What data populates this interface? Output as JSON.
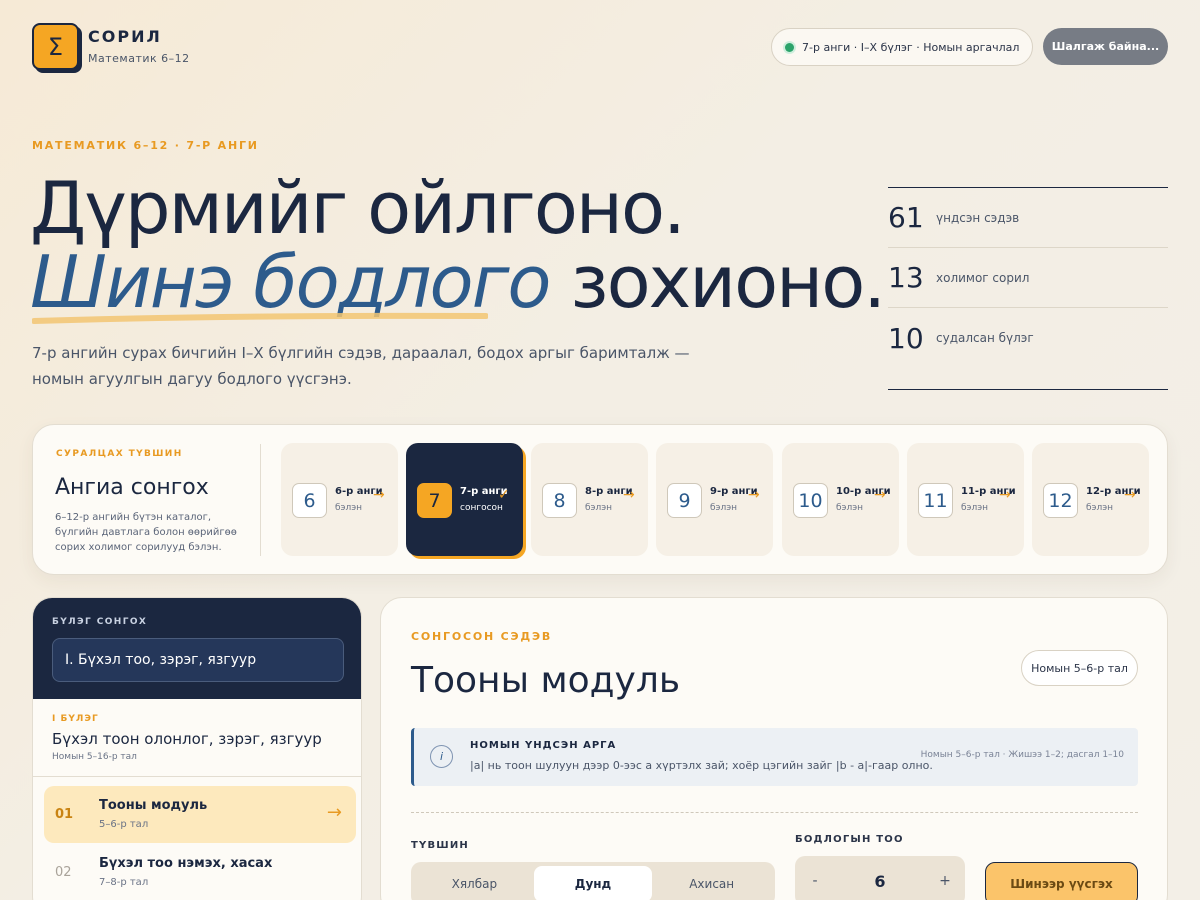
{
  "brand": {
    "logo_symbol": "Σ",
    "name": "СОРИЛ",
    "subtitle": "Математик 6–12",
    "accent": "#f5a623"
  },
  "header": {
    "context": "7-р анги · I–X бүлэг · Номын аргачлал",
    "status_button": "Шалгаж байна..."
  },
  "hero": {
    "eyebrow": "МАТЕМАТИК 6–12 · 7-Р АНГИ",
    "line1": "Дүрмийг ойлгоно.",
    "line2_accent": "Шинэ бодлого",
    "line2_rest": " зохионо.",
    "lead": "7-р ангийн сурах бичгийн I–X бүлгийн сэдэв, дараалал, бодох аргыг баримталж — номын агуулгын дагуу бодлого үүсгэнэ."
  },
  "stats": [
    {
      "value": "61",
      "label": "үндсэн сэдэв"
    },
    {
      "value": "13",
      "label": "холимог сорил"
    },
    {
      "value": "10",
      "label": "судалсан бүлэг"
    }
  ],
  "grade_picker": {
    "eyebrow": "СУРАЛЦАХ ТҮВШИН",
    "title": "Ангиа сонгох",
    "description": "6–12-р ангийн бүтэн каталог, бүлгийн давтлага болон өөрийгөө сорих холимог сорилууд бэлэн.",
    "grades": [
      {
        "num": "6",
        "name": "6-р анги",
        "state": "бэлэн",
        "mark": "→"
      },
      {
        "num": "7",
        "name": "7-р анги",
        "state": "сонгосон",
        "mark": "✓"
      },
      {
        "num": "8",
        "name": "8-р анги",
        "state": "бэлэн",
        "mark": "→"
      },
      {
        "num": "9",
        "name": "9-р анги",
        "state": "бэлэн",
        "mark": "→"
      },
      {
        "num": "10",
        "name": "10-р анги",
        "state": "бэлэн",
        "mark": "→"
      },
      {
        "num": "11",
        "name": "11-р анги",
        "state": "бэлэн",
        "mark": "→"
      },
      {
        "num": "12",
        "name": "12-р анги",
        "state": "бэлэн",
        "mark": "→"
      }
    ]
  },
  "chapters": {
    "eyebrow": "БҮЛЭГ СОНГОХ",
    "selected": "I. Бүхэл тоо, зэрэг, язгуур",
    "chapter_label": "I БҮЛЭГ",
    "chapter_title": "Бүхэл тоон олонлог, зэрэг, язгуур",
    "chapter_pages": "Номын 5–16-р тал",
    "topics": [
      {
        "num": "01",
        "name": "Тооны модуль",
        "pages": "5–6-р тал",
        "arrow": "→"
      },
      {
        "num": "02",
        "name": "Бүхэл тоо нэмэх, хасах",
        "pages": "7–8-р тал"
      }
    ]
  },
  "main": {
    "eyebrow": "СОНГОСОН СЭДЭВ",
    "title": "Тооны модуль",
    "badge": "Номын 5–6-р тал",
    "method_icon": "i",
    "method_title": "НОМЫН ҮНДСЭН АРГА",
    "method_text": "|a| нь тоон шулуун дээр 0-ээс a хүртэлх зай; хоёр цэгийн зайг |b - a|-гаар олно.",
    "method_ref": "Номын 5–6-р тал · Жишээ 1–2; дасгал 1–10",
    "level_label": "ТҮВШИН",
    "levels": [
      "Хялбар",
      "Дунд",
      "Ахисан"
    ],
    "count_label": "БОДЛОГЫН ТОО",
    "count_minus": "-",
    "count_value": "6",
    "count_plus": "+",
    "generate_button": "Шинээр үүсгэх"
  }
}
